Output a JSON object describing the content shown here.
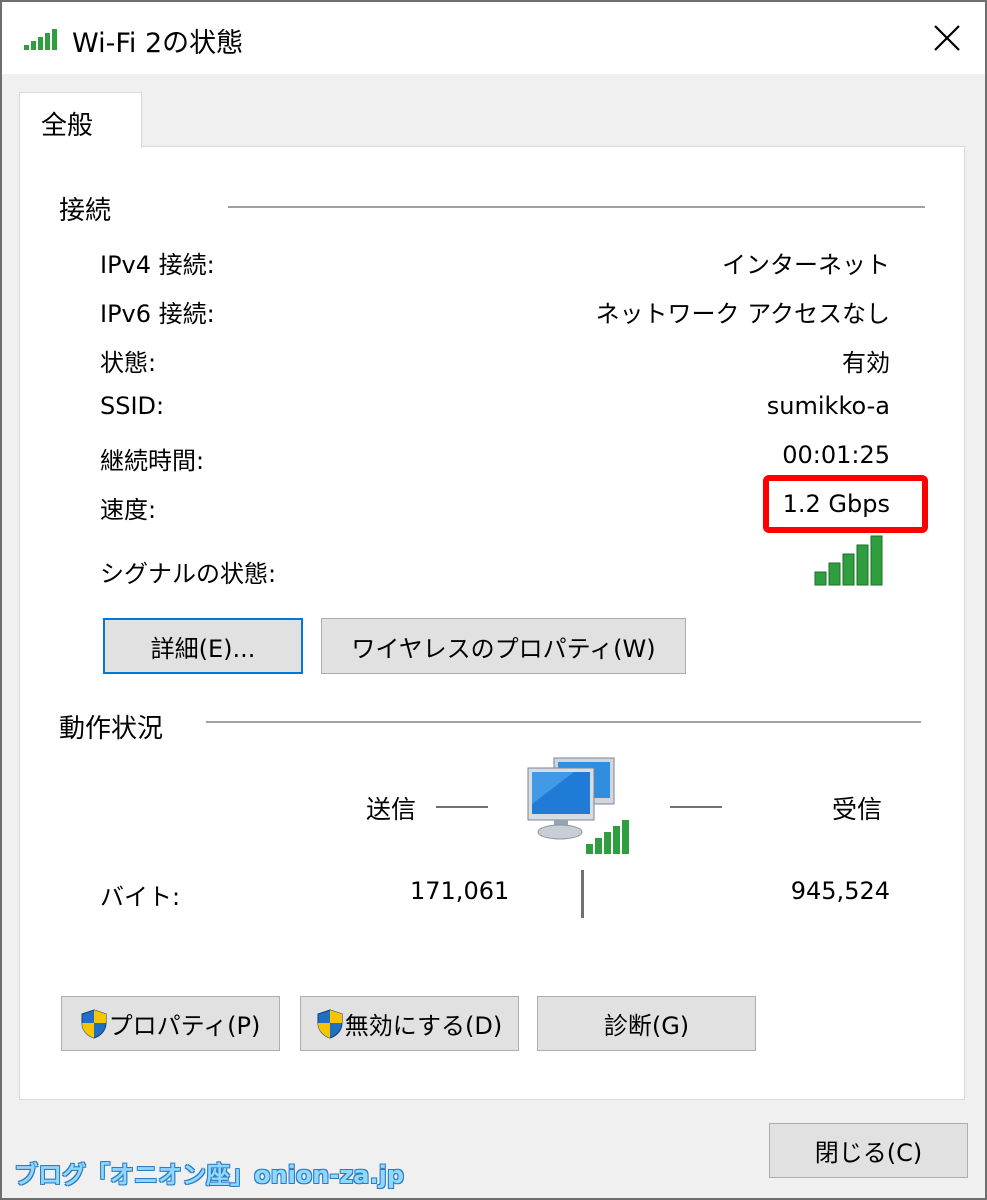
{
  "window": {
    "title": "Wi-Fi 2の状態"
  },
  "tabs": [
    {
      "label": "全般"
    }
  ],
  "connection": {
    "group_label": "接続",
    "rows": [
      {
        "label": "IPv4 接続:",
        "value": "インターネット"
      },
      {
        "label": "IPv6 接続:",
        "value": "ネットワーク アクセスなし"
      },
      {
        "label": "状態:",
        "value": "有効"
      },
      {
        "label": "SSID:",
        "value": "sumikko-a"
      },
      {
        "label": "継続時間:",
        "value": "00:01:25"
      },
      {
        "label": "速度:",
        "value": "1.2 Gbps"
      }
    ],
    "signal_label": "シグナルの状態:",
    "signal_bars": 5,
    "details_button": "詳細(E)...",
    "wireless_props_button": "ワイヤレスのプロパティ(W)"
  },
  "activity": {
    "group_label": "動作状況",
    "sent_label": "送信",
    "received_label": "受信",
    "bytes_label": "バイト:",
    "bytes_sent": "171,061",
    "bytes_received": "945,524"
  },
  "actions": {
    "properties_button": "プロパティ(P)",
    "disable_button": "無効にする(D)",
    "diagnose_button": "診断(G)"
  },
  "footer": {
    "close_button": "閉じる(C)"
  },
  "watermark": "ブログ「オニオン座」onion-za.jp",
  "colors": {
    "signal_green": "#2e9e3e",
    "highlight_red": "#ff0000",
    "focus_blue": "#0078d7",
    "shield_blue": "#1f6fc4",
    "shield_yellow": "#f6c400"
  }
}
